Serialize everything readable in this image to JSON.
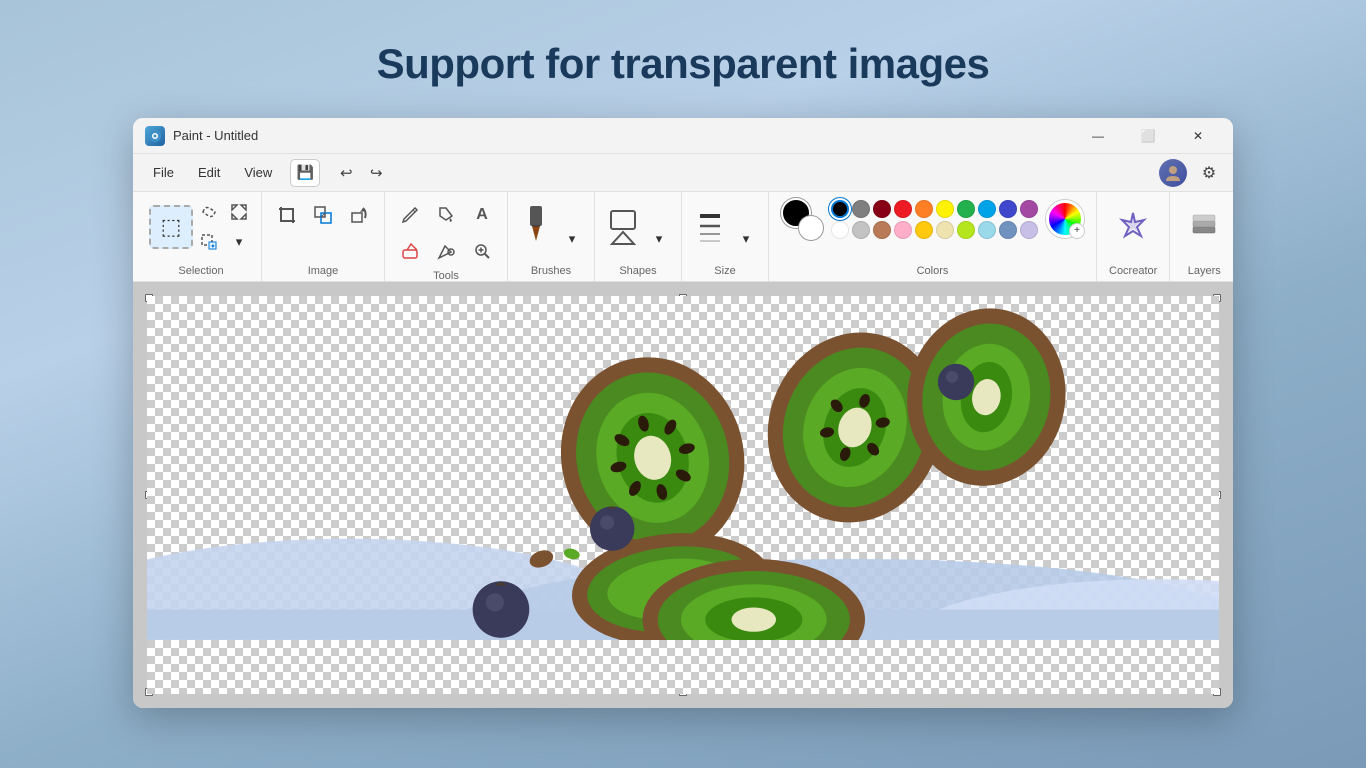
{
  "page": {
    "title": "Support for transparent images",
    "background_color": "#a8c4d8"
  },
  "window": {
    "title": "Paint - Untitled",
    "icon": "🎨",
    "controls": {
      "minimize": "—",
      "maximize": "⬜",
      "close": "✕"
    }
  },
  "menu": {
    "items": [
      "File",
      "Edit",
      "View"
    ],
    "save_label": "💾",
    "undo_label": "↩",
    "redo_label": "↪"
  },
  "toolbar": {
    "groups": [
      {
        "id": "selection",
        "label": "Selection",
        "buttons": [
          {
            "icon": "⬚",
            "label": "Rectangle select",
            "active": true
          },
          {
            "icon": "⬡",
            "label": "Free select"
          },
          {
            "icon": "✦",
            "label": "Magic select"
          },
          {
            "icon": "✂",
            "label": "Magic select AI"
          }
        ]
      },
      {
        "id": "image",
        "label": "Image",
        "buttons": [
          {
            "icon": "⤢",
            "label": "Crop"
          },
          {
            "icon": "🖼",
            "label": "Resize"
          },
          {
            "icon": "↻",
            "label": "Rotate/Flip"
          }
        ]
      },
      {
        "id": "tools",
        "label": "Tools",
        "buttons": [
          {
            "icon": "✏️",
            "label": "Pencil"
          },
          {
            "icon": "🪣",
            "label": "Fill"
          },
          {
            "icon": "A",
            "label": "Text"
          },
          {
            "icon": "🩹",
            "label": "Eraser"
          },
          {
            "icon": "💧",
            "label": "Color picker"
          },
          {
            "icon": "🔍",
            "label": "Zoom"
          }
        ]
      },
      {
        "id": "brushes",
        "label": "Brushes",
        "buttons": [
          {
            "icon": "≋",
            "label": "Brush"
          }
        ]
      },
      {
        "id": "shapes",
        "label": "Shapes",
        "buttons": [
          {
            "icon": "⬡",
            "label": "Shape"
          }
        ]
      },
      {
        "id": "size",
        "label": "Size",
        "buttons": [
          {
            "icon": "≡",
            "label": "Brush size"
          }
        ]
      }
    ],
    "colors": {
      "label": "Colors",
      "active_color": "#000000",
      "bg_color": "#ffffff",
      "row1": [
        "#000000",
        "#7f7f7f",
        "#880015",
        "#ed1c24",
        "#ff7f27",
        "#fff200",
        "#22b14c",
        "#00a2e8",
        "#3f48cc",
        "#a349a4"
      ],
      "row2": [
        "#ffffff",
        "#c3c3c3",
        "#b97a57",
        "#ffaec9",
        "#ffc90e",
        "#efe4b0",
        "#b5e61d",
        "#99d9ea",
        "#7092be",
        "#c8bfe7"
      ]
    },
    "cocreator": {
      "label": "Cocreator",
      "icon": "✦"
    },
    "layers": {
      "label": "Layers",
      "icon": "⬛"
    }
  },
  "canvas": {
    "background": "transparent_checker",
    "has_transparent": true
  }
}
